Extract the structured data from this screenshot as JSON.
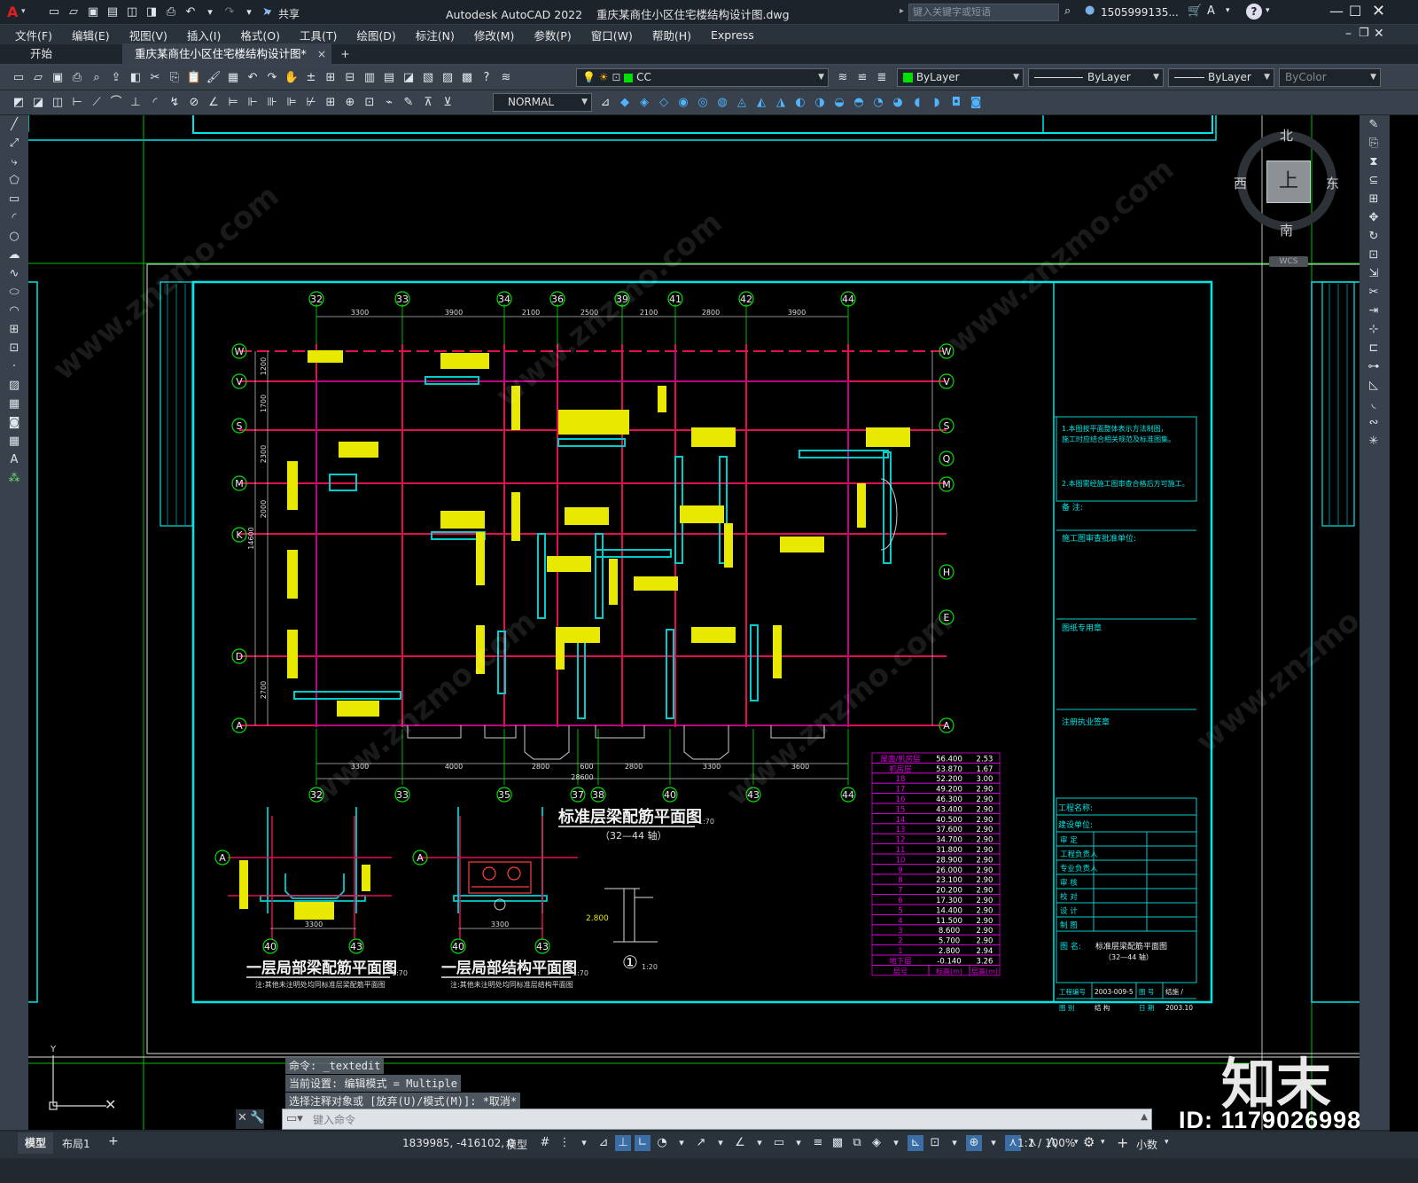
{
  "titlebar": {
    "app_icon": "A",
    "share": "共享",
    "title": "Autodesk AutoCAD 2022    重庆某商住小区住宅楼结构设计图.dwg",
    "search_placeholder": "键入关键字或短语",
    "user": "1505999135...",
    "help": "?"
  },
  "menu": [
    "文件(F)",
    "编辑(E)",
    "视图(V)",
    "插入(I)",
    "格式(O)",
    "工具(T)",
    "绘图(D)",
    "标注(N)",
    "修改(M)",
    "参数(P)",
    "窗口(W)",
    "帮助(H)",
    "Express"
  ],
  "tabs": {
    "start": "开始",
    "doc": "重庆某商住小区住宅楼结构设计图*",
    "close": "×",
    "add": "+"
  },
  "toolbar": {
    "layer": "CC",
    "color": "ByLayer",
    "linetype": "ByLayer",
    "lineweight": "ByLayer",
    "plotstyle": "ByColor",
    "dimstyle": "NORMAL"
  },
  "viewcube": {
    "north": "北",
    "south": "南",
    "east": "东",
    "west": "西",
    "top": "上",
    "wcs": "WCS"
  },
  "drawing": {
    "main_title": "标准层梁配筋平面图",
    "main_scale": "1:70",
    "main_sub": "（32—44 轴）",
    "sub1_title": "一层局部梁配筋平面图",
    "sub1_scale": "1:70",
    "sub1_note": "注:其他未注明处均同标准层梁配筋平面图",
    "sub2_title": "一层局部结构平面图",
    "sub2_scale": "1:70",
    "sub2_note": "注:其他未注明处均同标准层结构平面图",
    "detail_no": "①",
    "detail_scale": "1:20",
    "detail_elev": "2.800",
    "top_axes": [
      "32",
      "33",
      "34",
      "36",
      "39",
      "41",
      "42",
      "44"
    ],
    "top_dims": [
      "3300",
      "3900",
      "2100",
      "2500",
      "2100",
      "2800",
      "3900"
    ],
    "bottom_axes": [
      "32",
      "33",
      "35",
      "37",
      "38",
      "40",
      "43",
      "44"
    ],
    "bottom_dims": [
      "3300",
      "4000",
      "2800",
      "600",
      "2800",
      "3300",
      "3600"
    ],
    "bottom_total": "28600",
    "left_axes": [
      "W",
      "V",
      "S",
      "M",
      "K",
      "D",
      "A"
    ],
    "right_axes": [
      "W",
      "V",
      "S",
      "Q",
      "M",
      "H",
      "E",
      "A"
    ],
    "left_dims": [
      "1200",
      "1700",
      "2300",
      "2000",
      "2700"
    ],
    "left_total": "14600",
    "sub_axes": [
      "40",
      "43"
    ],
    "sub_dim": "3300",
    "sub_row": "A",
    "notes": [
      "1.本图按平面整体表示方法制图，",
      "  施工时应结合相关规范及标准图集。",
      "2.本图需经施工图审查合格后方可施工。"
    ],
    "tb_labels": [
      "备  注:",
      "施工图审查批准单位:",
      "图纸专用章",
      "注册执业签章",
      "工程名称:",
      "建设单位:"
    ],
    "tb_roles": [
      "审   定",
      "工程负责人",
      "专业负责人",
      "审   核",
      "校   对",
      "设   计",
      "制   图"
    ],
    "tb_name_label": "图  名:",
    "tb_name": "标准层梁配筋平面图",
    "tb_name_sub": "（32—44 轴）",
    "tb_footer": [
      [
        "工程编号",
        "2003-009-5",
        "图  号",
        "结施  /"
      ],
      [
        "图    别",
        "结  构",
        "日  期",
        "2003.10"
      ]
    ],
    "floor_table": {
      "header": [
        "屋面/机房层",
        "56.400",
        "2.53"
      ],
      "rows": [
        [
          "机房层",
          "53.870",
          "1.67"
        ],
        [
          "18",
          "52.200",
          "3.00"
        ],
        [
          "17",
          "49.200",
          "2.90"
        ],
        [
          "16",
          "46.300",
          "2.90"
        ],
        [
          "15",
          "43.400",
          "2.90"
        ],
        [
          "14",
          "40.500",
          "2.90"
        ],
        [
          "13",
          "37.600",
          "2.90"
        ],
        [
          "12",
          "34.700",
          "2.90"
        ],
        [
          "11",
          "31.800",
          "2.90"
        ],
        [
          "10",
          "28.900",
          "2.90"
        ],
        [
          "9",
          "26.000",
          "2.90"
        ],
        [
          "8",
          "23.100",
          "2.90"
        ],
        [
          "7",
          "20.200",
          "2.90"
        ],
        [
          "6",
          "17.300",
          "2.90"
        ],
        [
          "5",
          "14.400",
          "2.90"
        ],
        [
          "4",
          "11.500",
          "2.90"
        ],
        [
          "3",
          "8.600",
          "2.90"
        ],
        [
          "2",
          "5.700",
          "2.90"
        ],
        [
          "1",
          "2.800",
          "2.94"
        ],
        [
          "地下层",
          "-0.140",
          "3.26"
        ]
      ],
      "footer": [
        "层号",
        "标高(m)",
        "层高(m)"
      ]
    }
  },
  "command": {
    "history": [
      "命令: _textedit",
      "当前设置: 编辑模式 = Multiple",
      "选择注释对象或 [放弃(U)/模式(M)]: *取消*"
    ],
    "placeholder": "键入命令"
  },
  "status": {
    "model_tab": "模型",
    "layout_tab": "布局1",
    "coords": "1839985, -416102, 0",
    "mode": "模型",
    "scale": "1:1 / 100%",
    "units": "小数"
  },
  "watermark": {
    "logo": "知末",
    "id": "ID: 1179026998",
    "site": "www.znzmo.com"
  }
}
